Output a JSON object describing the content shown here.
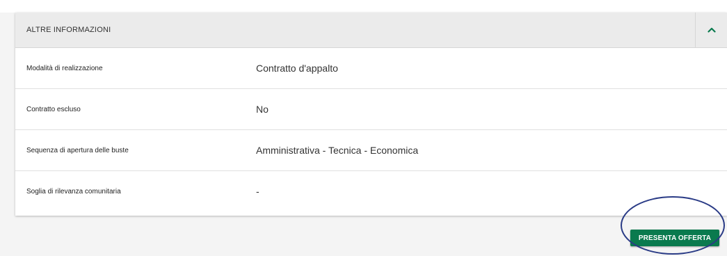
{
  "section": {
    "title": "ALTRE INFORMAZIONI",
    "toggle_icon": "chevron-up-icon",
    "rows": [
      {
        "label": "Modalità di realizzazione",
        "value": "Contratto d'appalto"
      },
      {
        "label": "Contratto escluso",
        "value": "No"
      },
      {
        "label": "Sequenza di apertura delle buste",
        "value": "Amministrativa - Tecnica - Economica"
      },
      {
        "label": "Soglia di rilevanza comunitaria",
        "value": "-"
      }
    ]
  },
  "actions": {
    "submit_label": "PRESENTA OFFERTA"
  },
  "colors": {
    "accent_green": "#0a7a4e",
    "highlight_circle": "#2a3b86",
    "header_bg": "#ebebeb"
  }
}
